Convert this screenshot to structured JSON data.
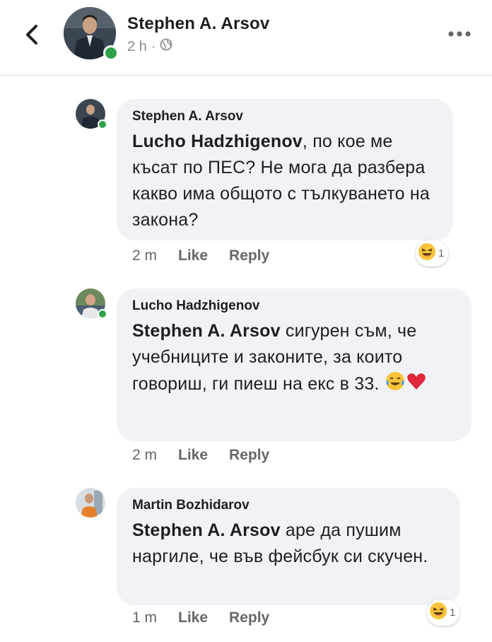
{
  "header": {
    "name": "Stephen A. Arsov",
    "time": "2 h"
  },
  "comments": [
    {
      "author": "Stephen A. Arsov",
      "mention": "Lucho Hadzhigenov",
      "text": ", по кое ме късат по ПЕС? Не мога да разбера какво има общото с тълкуването на закона?",
      "time": "2 m",
      "like": "Like",
      "reply": "Reply",
      "reaction_count": "1"
    },
    {
      "author": "Lucho Hadzhigenov",
      "mention": "Stephen A. Arsov",
      "text": " сигурен съм, че учебниците и законите, за които говориш, ги пиеш на екс в 33.",
      "time": "2 m",
      "like": "Like",
      "reply": "Reply"
    },
    {
      "author": "Martin Bozhidarov",
      "mention": "Stephen A. Arsov",
      "text": " аре да пушим наргиле, че във фейсбук си скучен.",
      "time": "1 m",
      "like": "Like",
      "reply": "Reply",
      "reaction_count": "1"
    }
  ],
  "colors": {
    "online": "#31a24c",
    "bubble": "#f0f2f5",
    "meta": "#65676b"
  }
}
